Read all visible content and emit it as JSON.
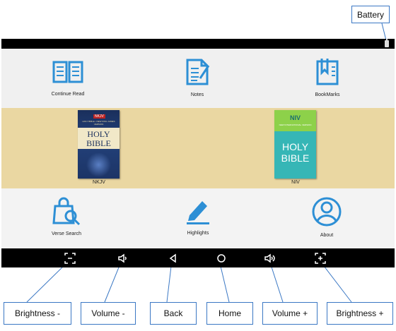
{
  "callouts": {
    "battery": "Battery",
    "brightness_minus": "Brightness -",
    "volume_minus": "Volume -",
    "back": "Back",
    "home": "Home",
    "volume_plus": "Volume +",
    "brightness_plus": "Brightness +"
  },
  "top_row": [
    {
      "label": "Continue Read",
      "icon": "open-book-icon"
    },
    {
      "label": "Notes",
      "icon": "notepad-pencil-icon"
    },
    {
      "label": "BookMarks",
      "icon": "bookmark-icon"
    }
  ],
  "books": [
    {
      "label": "NKJV",
      "cover_badge": "NKJV",
      "cover_subtitle": "HOLY BIBLE • NEW KING JAMES VERSION",
      "title_line1": "HOLY",
      "title_line2": "BIBLE"
    },
    {
      "label": "NIV",
      "cover_badge": "NIV",
      "cover_subtitle": "NEW INTERNATIONAL VERSION",
      "title_line1": "HOLY",
      "title_line2": "BIBLE"
    }
  ],
  "bottom_row": [
    {
      "label": "Verse Search",
      "icon": "shopping-bag-search-icon"
    },
    {
      "label": "Highlights",
      "icon": "highlighter-pen-icon"
    },
    {
      "label": "About",
      "icon": "user-circle-icon"
    }
  ],
  "nav_icons": [
    "brightness-minus-icon",
    "volume-minus-icon",
    "back-icon",
    "home-icon",
    "volume-plus-icon",
    "brightness-plus-icon"
  ],
  "colors": {
    "accent": "#2d8fd5",
    "status_bar": "#000000",
    "book_row_bg": "#ead7a2",
    "callout_border": "#3b78c4"
  }
}
